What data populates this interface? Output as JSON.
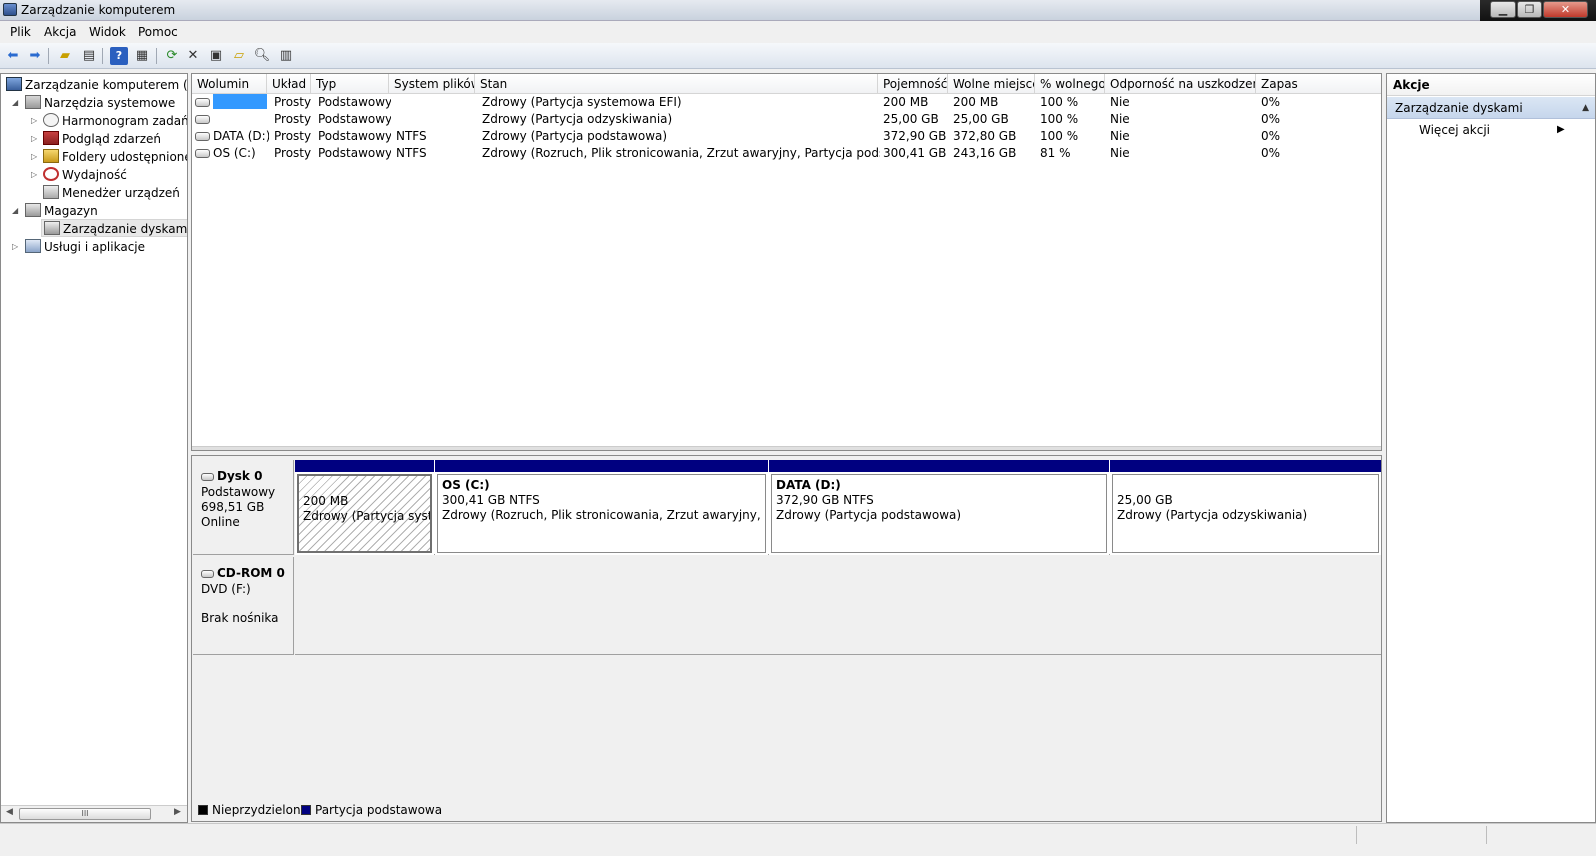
{
  "window": {
    "title": "Zarządzanie komputerem"
  },
  "menu": [
    "Plik",
    "Akcja",
    "Widok",
    "Pomoc"
  ],
  "tree": {
    "root": "Zarządzanie komputerem (loka",
    "items": [
      {
        "label": "Narzędzia systemowe"
      },
      {
        "label": "Harmonogram zadań"
      },
      {
        "label": "Podgląd zdarzeń"
      },
      {
        "label": "Foldery udostępnione"
      },
      {
        "label": "Wydajność"
      },
      {
        "label": "Menedżer urządzeń"
      },
      {
        "label": "Magazyn"
      },
      {
        "label": "Zarządzanie dyskami"
      },
      {
        "label": "Usługi i aplikacje"
      }
    ],
    "scroll_thumb": "III"
  },
  "volumes": {
    "columns": [
      "Wolumin",
      "Układ",
      "Typ",
      "System plików",
      "Stan",
      "Pojemność",
      "Wolne miejsce",
      "% wolnego",
      "Odporność na uszkodzenia",
      "Zapas"
    ],
    "rows": [
      [
        "",
        "Prosty",
        "Podstawowy",
        "",
        "Zdrowy (Partycja systemowa EFI)",
        "200 MB",
        "200 MB",
        "100 %",
        "Nie",
        "0%"
      ],
      [
        "",
        "Prosty",
        "Podstawowy",
        "",
        "Zdrowy (Partycja odzyskiwania)",
        "25,00 GB",
        "25,00 GB",
        "100 %",
        "Nie",
        "0%"
      ],
      [
        "DATA (D:)",
        "Prosty",
        "Podstawowy",
        "NTFS",
        "Zdrowy (Partycja podstawowa)",
        "372,90 GB",
        "372,80 GB",
        "100 %",
        "Nie",
        "0%"
      ],
      [
        "OS (C:)",
        "Prosty",
        "Podstawowy",
        "NTFS",
        "Zdrowy (Rozruch, Plik stronicowania, Zrzut awaryjny, Partycja podstawowa)",
        "300,41 GB",
        "243,16 GB",
        "81 %",
        "Nie",
        "0%"
      ]
    ]
  },
  "disks": [
    {
      "title": "Dysk 0",
      "lines": [
        "Podstawowy",
        "698,51 GB",
        "Online"
      ],
      "partitions": [
        {
          "name": "",
          "size": "200 MB",
          "status": "Zdrowy (Partycja systemowa EFI)"
        },
        {
          "name": "OS  (C:)",
          "size": "300,41 GB NTFS",
          "status": "Zdrowy (Rozruch, Plik stronicowania, Zrzut awaryjny, Partycja podstawowa)"
        },
        {
          "name": "DATA  (D:)",
          "size": "372,90 GB NTFS",
          "status": "Zdrowy (Partycja podstawowa)"
        },
        {
          "name": "",
          "size": "25,00 GB",
          "status": "Zdrowy (Partycja odzyskiwania)"
        }
      ]
    },
    {
      "title": "CD-ROM 0",
      "lines": [
        "DVD (F:)",
        "",
        "Brak nośnika"
      ]
    }
  ],
  "legend": [
    {
      "label": "Nieprzydzielone",
      "color": "#000000"
    },
    {
      "label": "Partycja podstawowa",
      "color": "#000080"
    }
  ],
  "actions": {
    "title": "Akcje",
    "section": "Zarządzanie dyskami",
    "item": "Więcej akcji"
  }
}
